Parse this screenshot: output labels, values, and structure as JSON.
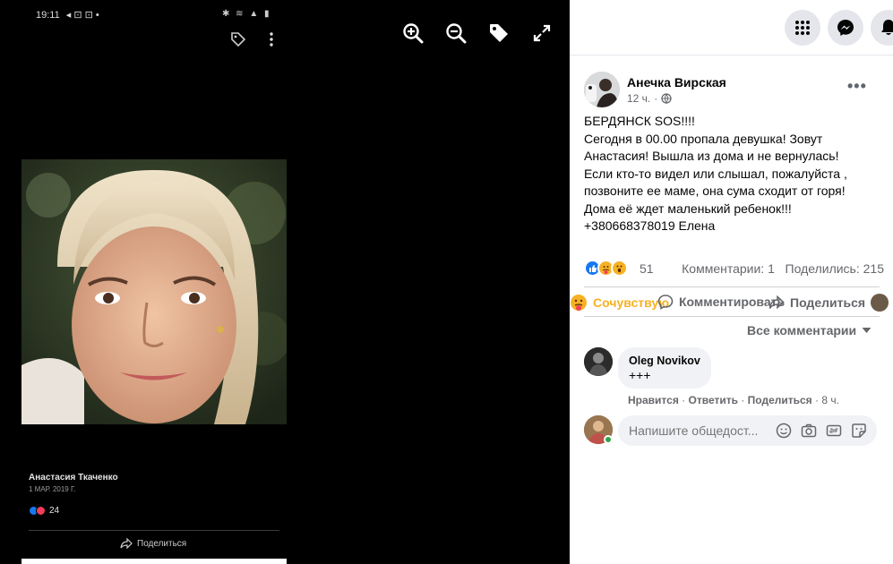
{
  "viewer": {
    "tools": [
      "zoom-in",
      "zoom-out",
      "tag",
      "fullscreen"
    ],
    "phone_status": {
      "time": "19:11",
      "indicators": "◂ ⊡ ⊡ •",
      "right_indicators": "✱ ≋ ▲ ▮"
    },
    "image_post": {
      "author": "Анастасия Ткаченко",
      "date": "1 МАР. 2019 Г.",
      "reaction_count": "24",
      "share_label": "Поделиться"
    }
  },
  "post": {
    "author": "Анечка Вирская",
    "time": "12 ч.",
    "more": "•••",
    "lines": [
      "БЕРДЯНСК SOS!!!!",
      "Сегодня в 00.00 пропала девушка! Зовут",
      "Анастасия! Вышла из дома и не вернулась!",
      "Если кто-то видел или слышал, пожалуйста ,",
      "позвоните ее маме, она сума сходит от горя!",
      "Дома её ждет маленький ребенок!!!",
      "+380668378019 Елена"
    ],
    "reaction_count": "51",
    "comments_count": "Комментарии: 1",
    "shares_count": "Поделились: 215",
    "actions": {
      "care": "Сочувствую",
      "comment": "Комментировать",
      "share": "Поделиться"
    },
    "all_comments": "Все комментарии"
  },
  "comment": {
    "author": "Oleg Novikov",
    "text": "+++",
    "like": "Нравится",
    "reply": "Ответить",
    "share": "Поделиться",
    "time": "8 ч."
  },
  "composer": {
    "placeholder": "Напишите общедост..."
  },
  "colors": {
    "accent": "#1877f2",
    "care_yellow": "#f7b125",
    "love_red": "#f33e58",
    "online_green": "#31a24c"
  }
}
